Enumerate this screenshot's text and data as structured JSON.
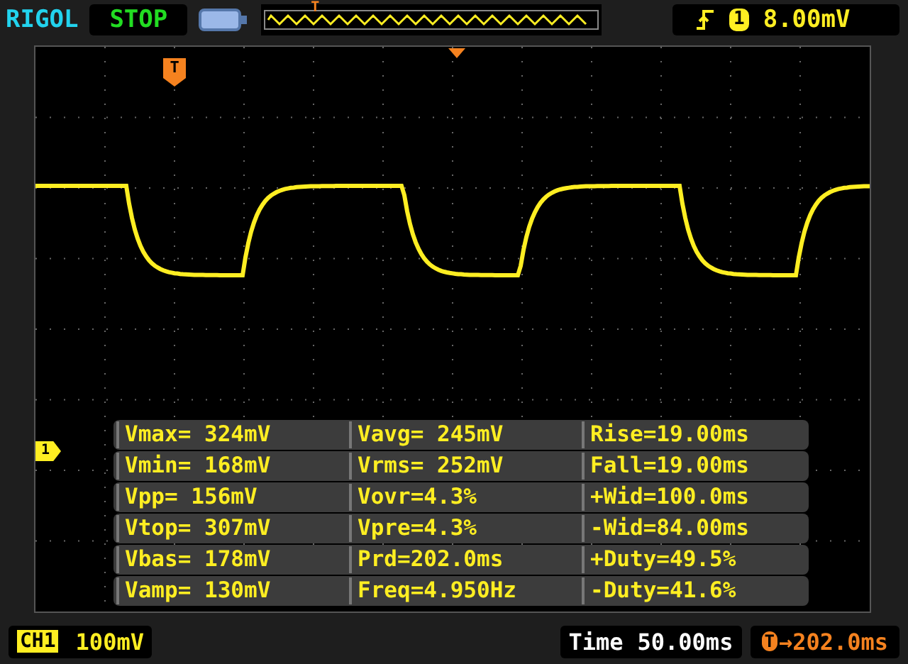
{
  "top_bar": {
    "brand": "RIGOL",
    "run_state": "STOP",
    "memory_marker": "T",
    "trigger": {
      "channel": "1",
      "level": "8.00mV"
    }
  },
  "screen": {
    "trigger_marker": "T",
    "channel_marker": "1"
  },
  "measurements": [
    {
      "cells": [
        "Vmax= 324mV",
        "Vavg= 245mV",
        "Rise=19.00ms"
      ]
    },
    {
      "cells": [
        "Vmin= 168mV",
        "Vrms= 252mV",
        "Fall=19.00ms"
      ]
    },
    {
      "cells": [
        "Vpp= 156mV",
        "Vovr=4.3%",
        "+Wid=100.0ms"
      ]
    },
    {
      "cells": [
        "Vtop= 307mV",
        "Vpre=4.3%",
        "-Wid=84.00ms"
      ]
    },
    {
      "cells": [
        "Vbas= 178mV",
        "Prd=202.0ms",
        "+Duty=49.5%"
      ]
    },
    {
      "cells": [
        "Vamp= 130mV",
        "Freq=4.950Hz",
        "-Duty=41.6%"
      ]
    }
  ],
  "status_bar": {
    "channel": "CH1",
    "scale": "100mV",
    "time_label": "Time",
    "time_scale": "50.00ms",
    "trigger_badge": "T",
    "trigger_offset": "→202.0ms"
  }
}
